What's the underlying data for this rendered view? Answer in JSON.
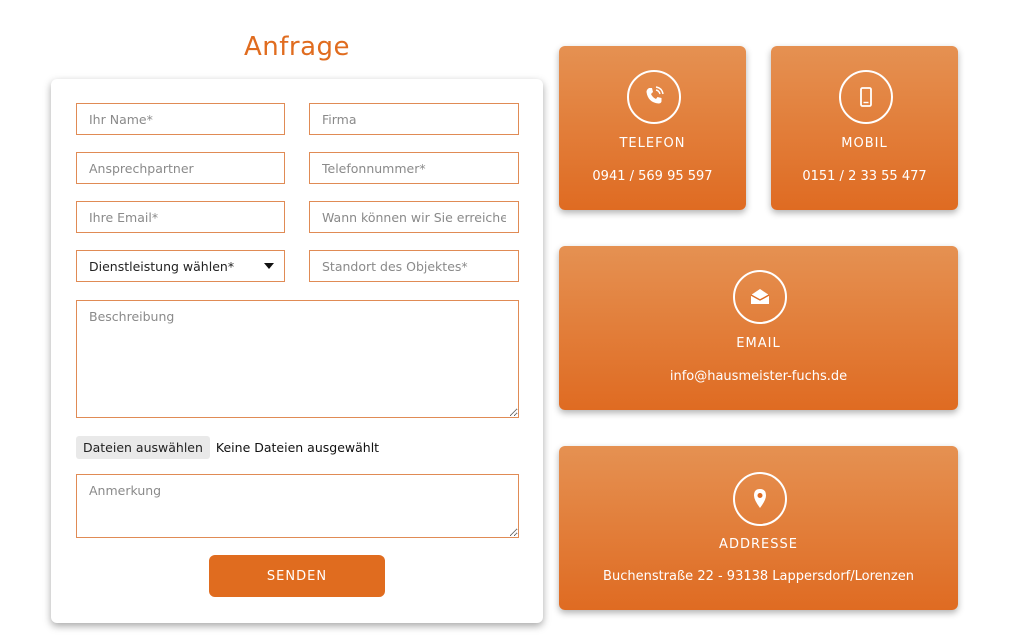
{
  "form": {
    "title": "Anfrage",
    "fields": {
      "name": "Ihr Name*",
      "company": "Firma",
      "contact_person": "Ansprechpartner",
      "phone": "Telefonnummer*",
      "email": "Ihre Email*",
      "reachable": "Wann können wir Sie erreichen",
      "service": "Dienstleistung wählen*",
      "location": "Standort des Objektes*",
      "description": "Beschreibung",
      "note": "Anmerkung"
    },
    "file": {
      "button_label": "Dateien auswählen",
      "status": "Keine Dateien ausgewählt"
    },
    "send_label": "SENDEN"
  },
  "contact": {
    "phone": {
      "label": "TELEFON",
      "value": "0941 / 569 95 597",
      "icon": "phone-icon"
    },
    "mobile": {
      "label": "MOBIL",
      "value": "0151 / 2 33 55 477",
      "icon": "mobile-icon"
    },
    "email": {
      "label": "EMAIL",
      "value": "info@hausmeister-fuchs.de",
      "icon": "envelope-icon"
    },
    "address": {
      "label": "ADDRESSE",
      "value": "Buchenstraße 22 - 93138 Lappersdorf/Lorenzen",
      "icon": "location-pin-icon"
    }
  },
  "colors": {
    "accent": "#e06c1f",
    "card_top": "#e59152",
    "card_bottom": "#df6b22"
  }
}
